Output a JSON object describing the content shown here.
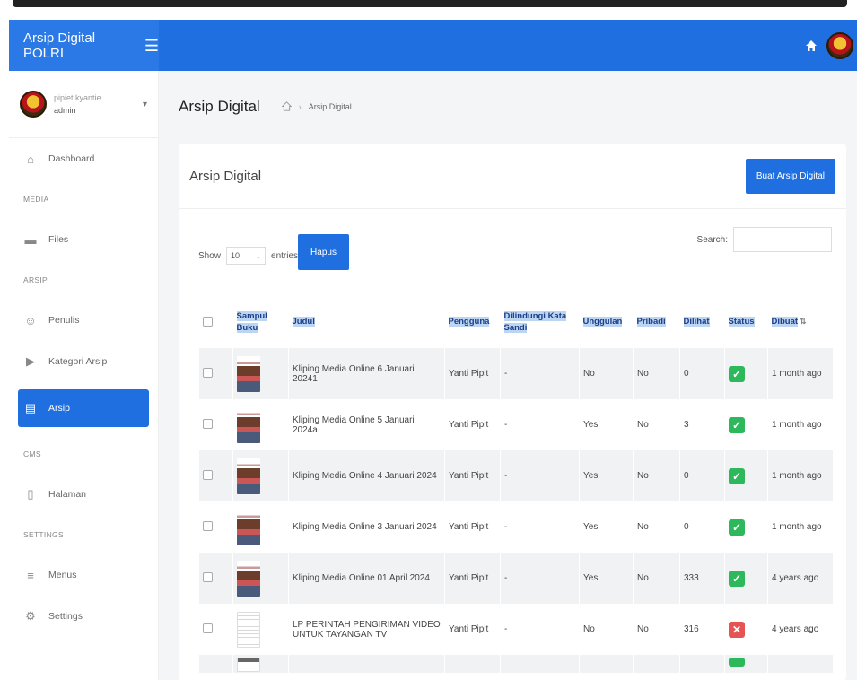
{
  "app": {
    "brand": "Arsip Digital POLRI"
  },
  "user": {
    "name": "pipiet kyantie",
    "role": "admin"
  },
  "sidebar": {
    "items": [
      {
        "type": "item",
        "label": "Dashboard",
        "icon": "home-icon",
        "glyph": "⌂"
      },
      {
        "type": "header",
        "label": "MEDIA"
      },
      {
        "type": "item",
        "label": "Files",
        "icon": "folder-icon",
        "glyph": "▬"
      },
      {
        "type": "header",
        "label": "ARSIP"
      },
      {
        "type": "item",
        "label": "Penulis",
        "icon": "users-icon",
        "glyph": "☺"
      },
      {
        "type": "item",
        "label": "Kategori Arsip",
        "icon": "tag-icon",
        "glyph": "▶"
      },
      {
        "type": "item",
        "label": "Arsip",
        "icon": "book-icon",
        "glyph": "▤",
        "active": true
      },
      {
        "type": "header",
        "label": "CMS"
      },
      {
        "type": "item",
        "label": "Halaman",
        "icon": "page-icon",
        "glyph": "▯"
      },
      {
        "type": "header",
        "label": "SETTINGS"
      },
      {
        "type": "item",
        "label": "Menus",
        "icon": "list-icon",
        "glyph": "≡"
      },
      {
        "type": "item",
        "label": "Settings",
        "icon": "gear-icon",
        "glyph": "⚙"
      }
    ]
  },
  "page": {
    "title": "Arsip Digital",
    "breadcrumb_current": "Arsip Digital"
  },
  "card": {
    "title": "Arsip Digital",
    "create_button": "Buat Arsip Digital"
  },
  "controls": {
    "show_label": "Show",
    "entries_value": "10",
    "entries_label": "entries",
    "delete_button": "Hapus",
    "search_label": "Search:"
  },
  "table": {
    "columns": [
      "Sampul Buku",
      "Judul",
      "Pengguna",
      "Dilindungi Kata Sandi",
      "Unggulan",
      "Pribadi",
      "Dilihat",
      "Status",
      "Dibuat"
    ],
    "rows": [
      {
        "judul": "Kliping Media Online 6 Januari 20241",
        "pengguna": "Yanti Pipit",
        "sandi": "-",
        "unggulan": "No",
        "pribadi": "No",
        "dilihat": "0",
        "status": "ok",
        "dibuat": "1 month ago",
        "thumb": "klip"
      },
      {
        "judul": "Kliping Media Online 5 Januari 2024a",
        "pengguna": "Yanti Pipit",
        "sandi": "-",
        "unggulan": "Yes",
        "pribadi": "No",
        "dilihat": "3",
        "status": "ok",
        "dibuat": "1 month ago",
        "thumb": "klip"
      },
      {
        "judul": "Kliping Media Online 4 Januari 2024",
        "pengguna": "Yanti Pipit",
        "sandi": "-",
        "unggulan": "Yes",
        "pribadi": "No",
        "dilihat": "0",
        "status": "ok",
        "dibuat": "1 month ago",
        "thumb": "klip"
      },
      {
        "judul": "Kliping Media Online 3 Januari 2024",
        "pengguna": "Yanti Pipit",
        "sandi": "-",
        "unggulan": "Yes",
        "pribadi": "No",
        "dilihat": "0",
        "status": "ok",
        "dibuat": "1 month ago",
        "thumb": "klip"
      },
      {
        "judul": "Kliping Media Online 01 April 2024",
        "pengguna": "Yanti Pipit",
        "sandi": "-",
        "unggulan": "Yes",
        "pribadi": "No",
        "dilihat": "333",
        "status": "ok",
        "dibuat": "4 years ago",
        "thumb": "klip"
      },
      {
        "judul": "LP PERINTAH PENGIRIMAN VIDEO UNTUK TAYANGAN TV",
        "pengguna": "Yanti Pipit",
        "sandi": "-",
        "unggulan": "No",
        "pribadi": "No",
        "dilihat": "316",
        "status": "no",
        "dibuat": "4 years ago",
        "thumb": "doc"
      }
    ]
  },
  "colors": {
    "primary": "#1f6fe0",
    "success": "#2eb85c",
    "danger": "#e55353",
    "header_text": "#1a3f88"
  }
}
